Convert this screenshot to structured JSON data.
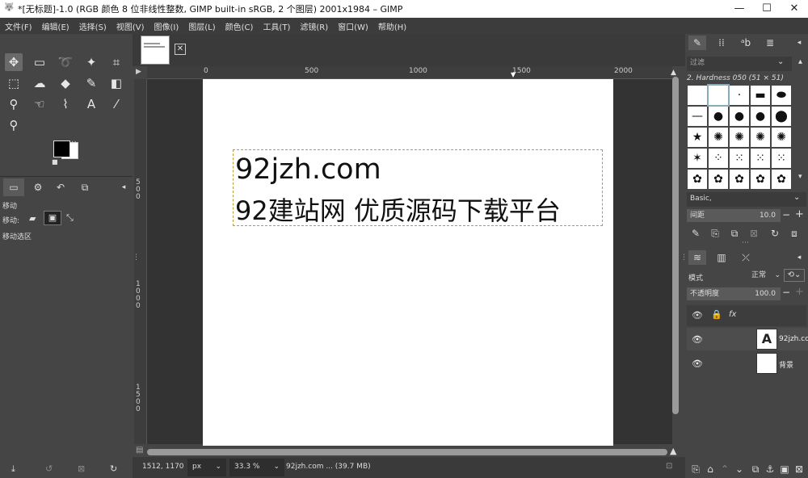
{
  "window": {
    "title": "*[无标题]-1.0 (RGB 颜色 8 位非线性整数, GIMP built-in sRGB, 2 个图层) 2001x1984 – GIMP",
    "minimize": "—",
    "maximize": "☐",
    "close": "✕"
  },
  "menu": [
    "文件(F)",
    "编辑(E)",
    "选择(S)",
    "视图(V)",
    "图像(I)",
    "图层(L)",
    "颜色(C)",
    "工具(T)",
    "滤镜(R)",
    "窗口(W)",
    "帮助(H)"
  ],
  "toolbox": {
    "tools": [
      {
        "name": "move-tool-icon",
        "glyph": "✥",
        "active": true
      },
      {
        "name": "rect-select-icon",
        "glyph": "▭"
      },
      {
        "name": "lasso-icon",
        "glyph": "➰"
      },
      {
        "name": "fuzzy-select-icon",
        "glyph": "✦"
      },
      {
        "name": "crop-icon",
        "glyph": "⌗"
      },
      {
        "name": "unified-transform-icon",
        "glyph": "⬚"
      },
      {
        "name": "warp-icon",
        "glyph": "☁"
      },
      {
        "name": "bucket-fill-icon",
        "glyph": "◆"
      },
      {
        "name": "paintbrush-icon",
        "glyph": "✎"
      },
      {
        "name": "eraser-icon",
        "glyph": "◧"
      },
      {
        "name": "clone-icon",
        "glyph": "⚲"
      },
      {
        "name": "smudge-icon",
        "glyph": "☜"
      },
      {
        "name": "paths-icon",
        "glyph": "⌇"
      },
      {
        "name": "text-tool-icon",
        "glyph": "A"
      },
      {
        "name": "color-picker-icon",
        "glyph": "⁄"
      },
      {
        "name": "zoom-icon",
        "glyph": "⚲"
      }
    ],
    "options_title": "移动",
    "move_label": "移动:",
    "move_selection": "移动选区"
  },
  "canvas": {
    "text_line1": "92jzh.com",
    "text_line2": "92建站网 优质源码下载平台",
    "ruler_h_labels": [
      "0",
      "500",
      "1000",
      "1500",
      "2000"
    ],
    "ruler_v_labels": [
      "5\n0\n0",
      "1\n0\n0\n0",
      "1\n5\n0\n0"
    ]
  },
  "status": {
    "coords": "1512, 1170",
    "unit": "px",
    "zoom": "33.3 %",
    "info": "92jzh.com ... (39.7 MB)"
  },
  "brushes": {
    "filter_placeholder": "过滤",
    "current": "2. Hardness 050 (51 × 51)",
    "preset": "Basic,",
    "spacing_label": "间距",
    "spacing_value": "10.0"
  },
  "layers": {
    "mode_label": "模式",
    "mode_value": "正常",
    "opacity_label": "不透明度",
    "opacity_value": "100.0",
    "items": [
      {
        "name": "92jzh.co",
        "type": "text"
      },
      {
        "name": "背景",
        "type": "raster"
      }
    ]
  }
}
